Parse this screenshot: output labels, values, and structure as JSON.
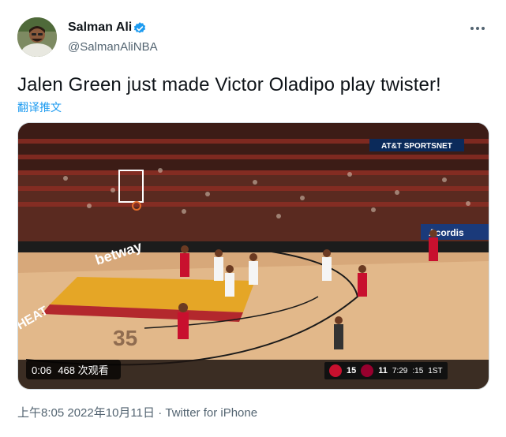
{
  "author": {
    "name": "Salman Ali",
    "handle": "@SalmanAliNBA"
  },
  "tweet": {
    "text": "Jalen Green just made Victor Oladipo play twister!",
    "translate_label": "翻译推文"
  },
  "video": {
    "elapsed": "0:06",
    "views": "468 次观看",
    "scoreboard": {
      "home_score": "15",
      "away_score": "11",
      "clock": "7:29",
      "shot_clock": ":15",
      "quarter": "1ST"
    },
    "arena_signs": {
      "att": "AT&T SPORTSNET",
      "acordis": "Acordis",
      "betway": "betway",
      "heat": "HEAT",
      "anniv": "35"
    }
  },
  "meta": {
    "time": "上午8:05",
    "date": "2022年10月11日",
    "separator": "·",
    "source": "Twitter for iPhone"
  },
  "colors": {
    "link": "#1d9bf0",
    "secondary": "#536471",
    "verified": "#1d9bf0"
  }
}
